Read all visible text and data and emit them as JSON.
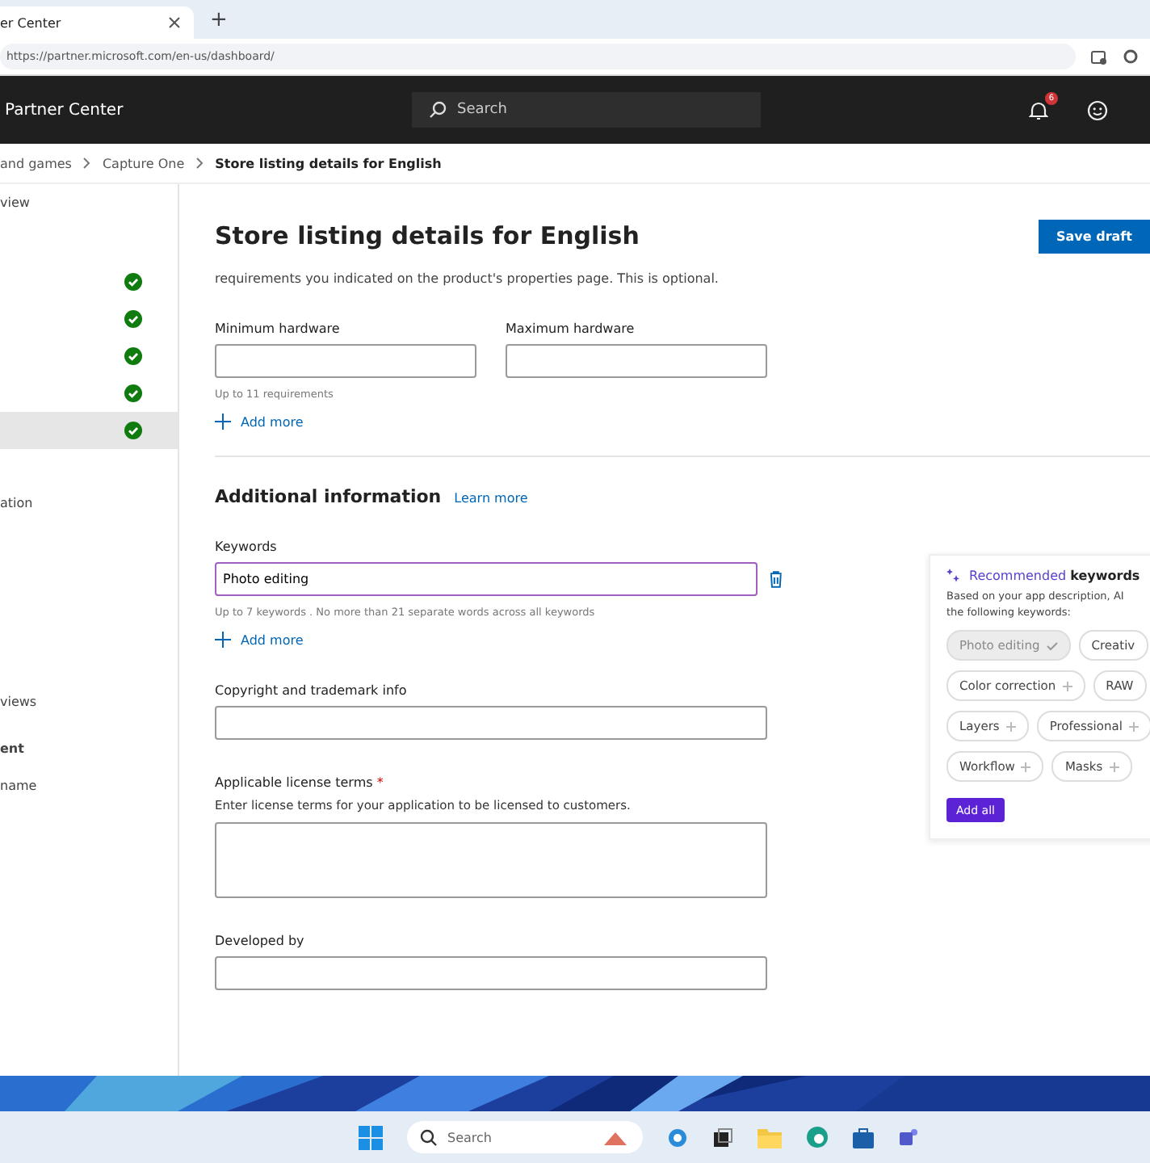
{
  "browser": {
    "tab_title": "er Center",
    "new_tab": "+",
    "address": "https://partner.microsoft.com/en-us/dashboard/"
  },
  "header": {
    "app_name": "Partner Center",
    "search_placeholder": "Search",
    "notification_count": "6"
  },
  "breadcrumb": [
    "and games",
    "Capture One",
    "Store listing details for English"
  ],
  "sidebar": {
    "items": [
      {
        "label": "view",
        "kind": "text",
        "selected": false
      },
      {
        "kind": "check",
        "selected": false
      },
      {
        "kind": "check",
        "selected": false
      },
      {
        "kind": "check",
        "selected": false
      },
      {
        "kind": "check",
        "selected": false
      },
      {
        "kind": "check",
        "selected": true
      },
      {
        "label": "ation",
        "kind": "text",
        "selected": false
      },
      {
        "label": "views",
        "kind": "text",
        "selected": false
      },
      {
        "label": "ent",
        "kind": "bold",
        "selected": false
      },
      {
        "label": "name",
        "kind": "text",
        "selected": false
      }
    ]
  },
  "page": {
    "title": "Store listing details for English",
    "save_button": "Save draft"
  },
  "requirements": {
    "description": "requirements you indicated on the product's properties page. This is optional.",
    "fields": [
      "Minimum hardware",
      "Maximum hardware"
    ],
    "hint": "Up to 11 requirements",
    "add_more": "Add more"
  },
  "additional": {
    "heading": "Additional information",
    "learn_more": "Learn more",
    "keywords_label": "Keywords",
    "keyword_value": "Photo editing",
    "keywords_hint": "Up to 7 keywords . No more than 21 separate words across all keywords",
    "add_more": "Add more",
    "copyright_label": "Copyright and trademark info",
    "license_label": "Applicable license terms",
    "license_required": "*",
    "license_hint": "Enter license terms for your application to be licensed to customers.",
    "developed_label": "Developed by"
  },
  "recommended": {
    "title_part": "Recommended",
    "title_rest": "keywords",
    "description": [
      "Based on your app description, AI",
      "the following keywords:"
    ],
    "chips": [
      {
        "label": "Photo editing",
        "selected": true
      },
      {
        "label": "Creativ",
        "selected": false
      },
      {
        "label": "Color correction",
        "selected": false
      },
      {
        "label": "RAW",
        "selected": false
      },
      {
        "label": "Layers",
        "selected": false
      },
      {
        "label": "Professional",
        "selected": false
      },
      {
        "label": "Workflow",
        "selected": false
      },
      {
        "label": "Masks",
        "selected": false
      }
    ],
    "add_all": "Add all"
  },
  "taskbar": {
    "search_placeholder": "Search"
  }
}
